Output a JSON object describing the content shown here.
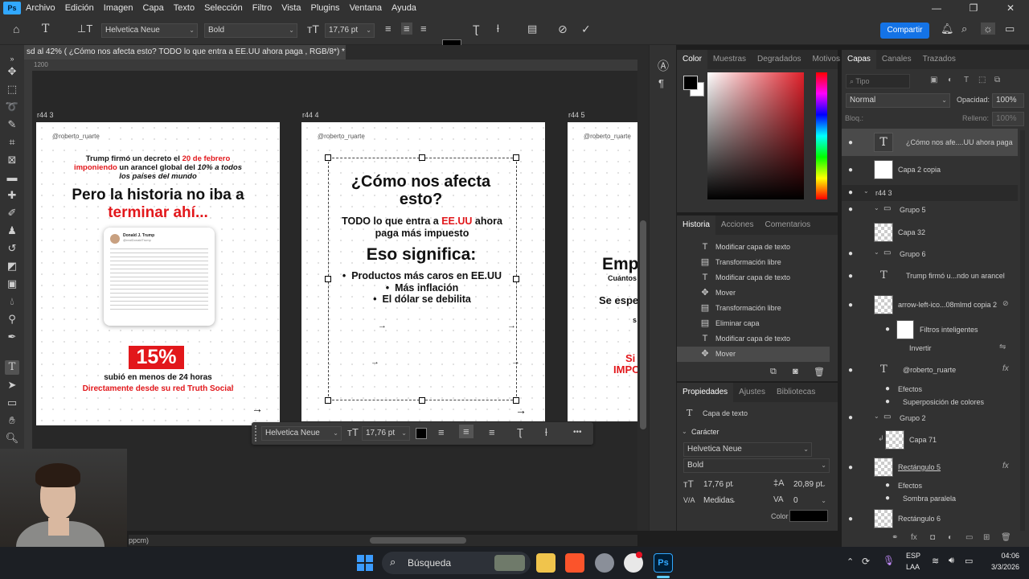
{
  "menubar": {
    "items": [
      "Archivo",
      "Edición",
      "Imagen",
      "Capa",
      "Texto",
      "Selección",
      "Filtro",
      "Vista",
      "Plugins",
      "Ventana",
      "Ayuda"
    ],
    "window_controls": [
      "—",
      "❐",
      "✕"
    ]
  },
  "options": {
    "font_family": "Helvetica Neue",
    "font_style": "Bold",
    "font_size": "17,76 pt",
    "share_label": "Compartir"
  },
  "document_tab": {
    "title": "sd al 42% (  ¿Cómo nos afecta esto?  TODO lo que entra a EE.UU ahora paga , RGB/8*) *",
    "close": "×"
  },
  "ruler": {
    "start": "1200"
  },
  "artboards": {
    "left": {
      "label": "r44 3",
      "handle": "@roberto_ruarte",
      "line1a": "Trump firmó un decreto el ",
      "line1b": "20 de febrero",
      "line2a": "imponiendo",
      "line2b": " un arancel global del ",
      "line2c": "10% a todos",
      "line3": "los países del mundo",
      "head1": "Pero la historia no iba a",
      "head2": "terminar ahí...",
      "tweet_name": "Donald J. Trump",
      "tweet_handle": "@realDonaldTrump",
      "percent": "15%",
      "sub1": "subió en menos de 24 horas",
      "sub2": "Directamente desde su red Truth Social",
      "arrow": "→"
    },
    "center": {
      "label": "r44 4",
      "handle": "@roberto_ruarte",
      "title1": "¿Cómo nos afecta",
      "title2": "esto?",
      "sub_a": "TODO lo que entra a ",
      "sub_b": "EE.UU",
      "sub_c": " ahora",
      "sub_d": "paga más impuesto",
      "head": "Eso significa:",
      "bullets": [
        "Productos más caros en EE.UU",
        "Más inflación",
        "El dólar se debilita"
      ],
      "arrow": "→"
    },
    "right": {
      "label": "r44 5",
      "handle": "@roberto_ruarte",
      "t1": "Emp",
      "t2": "Cuántos",
      "t3": "Se espe",
      "t4": "s",
      "t5": "Si",
      "t6": "IMPC"
    }
  },
  "ctxbar": {
    "font_family": "Helvetica Neue",
    "font_size": "17,76 pt",
    "more": "•••"
  },
  "status": {
    "text": "ppcm)"
  },
  "color_panel": {
    "tabs": [
      "Color",
      "Muestras",
      "Degradados",
      "Motivos"
    ],
    "fg": "#000000",
    "bg": "#ffffff"
  },
  "history_panel": {
    "tabs": [
      "Historia",
      "Acciones",
      "Comentarios"
    ],
    "rows": [
      {
        "icon": "T",
        "label": "Modificar capa de texto"
      },
      {
        "icon": "▤",
        "label": "Transformación libre"
      },
      {
        "icon": "T",
        "label": "Modificar capa de texto"
      },
      {
        "icon": "✥",
        "label": "Mover"
      },
      {
        "icon": "▤",
        "label": "Transformación libre"
      },
      {
        "icon": "▤",
        "label": "Eliminar capa"
      },
      {
        "icon": "T",
        "label": "Modificar capa de texto"
      },
      {
        "icon": "✥",
        "label": "Mover"
      }
    ]
  },
  "properties_panel": {
    "tabs": [
      "Propiedades",
      "Ajustes",
      "Bibliotecas"
    ],
    "type_label": "Capa de texto",
    "section": "Carácter",
    "font_family": "Helvetica Neue",
    "font_style": "Bold",
    "size": "17,76 pt",
    "leading": "20,89 pt",
    "kerning": "Medidas",
    "tracking": "0",
    "color_label": "Color",
    "va": "V/A"
  },
  "layers_panel": {
    "tabs": [
      "Capas",
      "Canales",
      "Trazados"
    ],
    "search": "Tipo",
    "blend": "Normal",
    "opacity_label": "Opacidad:",
    "opacity": "100%",
    "lock_label": "Bloq.:",
    "fill_label": "Relleno:",
    "fill": "100%",
    "layers": [
      "¿Cómo nos afe....UU ahora paga",
      "Capa 2 copia",
      "r44 3",
      "Grupo 5",
      "Capa 32",
      "Grupo 6",
      "Trump firmó u...ndo un arancel",
      "arrow-left-ico...08mlmd copia 2",
      "Filtros inteligentes",
      "Invertir",
      "@roberto_ruarte",
      "Efectos",
      "Superposición de colores",
      "Grupo 2",
      "Capa 71",
      "Rectángulo 5",
      "Efectos",
      "Sombra paralela",
      "Rectángulo 6"
    ],
    "fx": "fx"
  },
  "taskbar": {
    "search": "Búsqueda",
    "lang1": "ESP",
    "lang2": "LAA",
    "time": "04:06",
    "date": "3/3/2026",
    "ps": "Ps"
  },
  "colors": {
    "accent_red": "#e2171b",
    "ps_blue": "#31a8ff",
    "share_blue": "#1473e6"
  }
}
